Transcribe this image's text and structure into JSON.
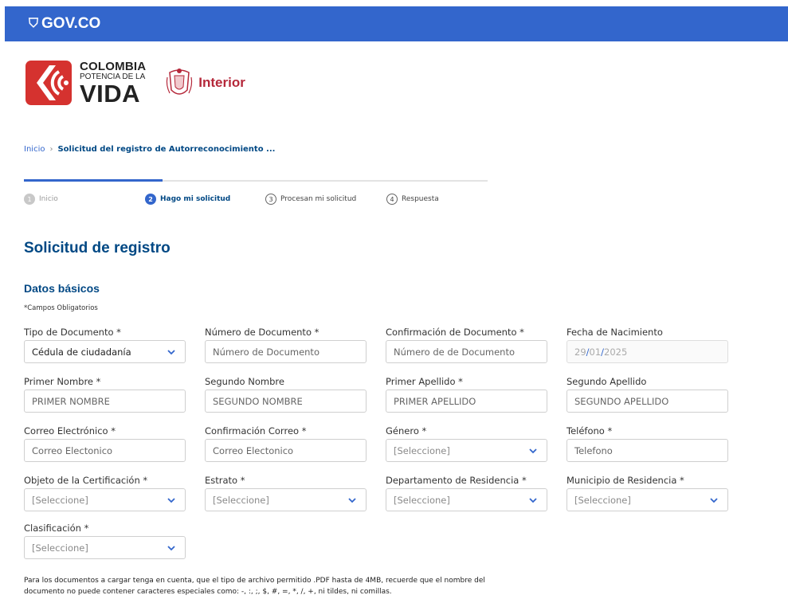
{
  "gov": {
    "logo": "GOV.CO"
  },
  "brand": {
    "line1": "COLOMBIA",
    "line2": "POTENCIA DE LA",
    "line3": "VIDA",
    "ministry": "Interior"
  },
  "breadcrumb": {
    "home": "Inicio",
    "separator": "›",
    "current": "Solicitud del registro de Autorreconocimiento ..."
  },
  "steps": [
    {
      "num": "1",
      "label": "Inicio",
      "state": "done"
    },
    {
      "num": "2",
      "label": "Hago mi solicitud",
      "state": "active"
    },
    {
      "num": "3",
      "label": "Procesan mi solicitud",
      "state": "todo"
    },
    {
      "num": "4",
      "label": "Respuesta",
      "state": "todo"
    }
  ],
  "page_title": "Solicitud de registro",
  "section_title": "Datos básicos",
  "required_note": "*Campos Obligatorios",
  "form": {
    "tipo_documento": {
      "label": "Tipo de Documento *",
      "value": "Cédula de ciudadanía"
    },
    "numero_documento": {
      "label": "Número de Documento *",
      "placeholder": "Número de Documento"
    },
    "confirmacion_documento": {
      "label": "Confirmación de Documento *",
      "placeholder": "Número de de Documento"
    },
    "fecha_nacimiento": {
      "label": "Fecha de Nacimiento",
      "day": "29",
      "sep1": "/",
      "month": "01",
      "sep2": "/",
      "year": "2025"
    },
    "primer_nombre": {
      "label": "Primer Nombre *",
      "placeholder": "PRIMER NOMBRE"
    },
    "segundo_nombre": {
      "label": "Segundo Nombre",
      "placeholder": "SEGUNDO NOMBRE"
    },
    "primer_apellido": {
      "label": "Primer Apellido *",
      "placeholder": "PRIMER APELLIDO"
    },
    "segundo_apellido": {
      "label": "Segundo Apellido",
      "placeholder": "SEGUNDO APELLIDO"
    },
    "correo": {
      "label": "Correo Electrónico *",
      "placeholder": "Correo Electonico"
    },
    "confirmacion_correo": {
      "label": "Confirmación Correo *",
      "placeholder": "Correo Electonico"
    },
    "genero": {
      "label": "Género *",
      "value": "[Seleccione]"
    },
    "telefono": {
      "label": "Teléfono *",
      "placeholder": "Telefono"
    },
    "objeto_certificacion": {
      "label": "Objeto de la Certificación *",
      "value": "[Seleccione]"
    },
    "estrato": {
      "label": "Estrato *",
      "value": "[Seleccione]"
    },
    "departamento": {
      "label": "Departamento de Residencia *",
      "value": "[Seleccione]"
    },
    "municipio": {
      "label": "Municipio de Residencia *",
      "value": "[Seleccione]"
    },
    "clasificacion": {
      "label": "Clasificación *",
      "value": "[Seleccione]"
    }
  },
  "note": {
    "line1": "Para los documentos a cargar tenga en cuenta, que el tipo de archivo permitido .PDF hasta de 4MB, recuerde que el nombre del",
    "line2": "documento no puede contener caracteres especiales como: -, :, ;, $, #, =, *, /, +, ni tildes, ni comillas."
  },
  "colors": {
    "gov_bar": "#3366cc",
    "primary_dark": "#004884",
    "accent_red": "#b5283a"
  }
}
